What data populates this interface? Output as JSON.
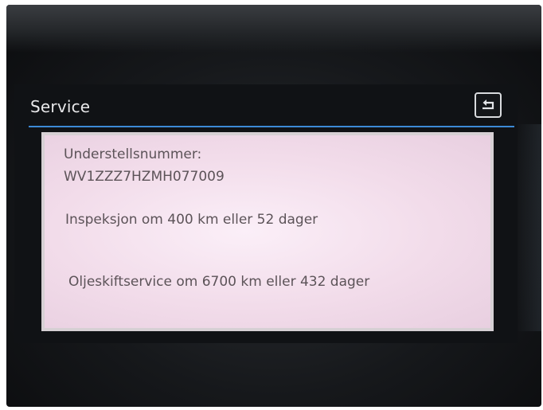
{
  "header": {
    "title": "Service",
    "back_icon": "return-arrow-icon",
    "accent_color": "#3d8ad6"
  },
  "service_info": {
    "vin_label": "Understellsnummer:",
    "vin_value": "WV1ZZZ7HZMH077009",
    "inspection": "Inspeksjon om 400 km eller 52 dager",
    "oil_change": "Oljeskiftservice om 6700 km eller 432 dager"
  }
}
